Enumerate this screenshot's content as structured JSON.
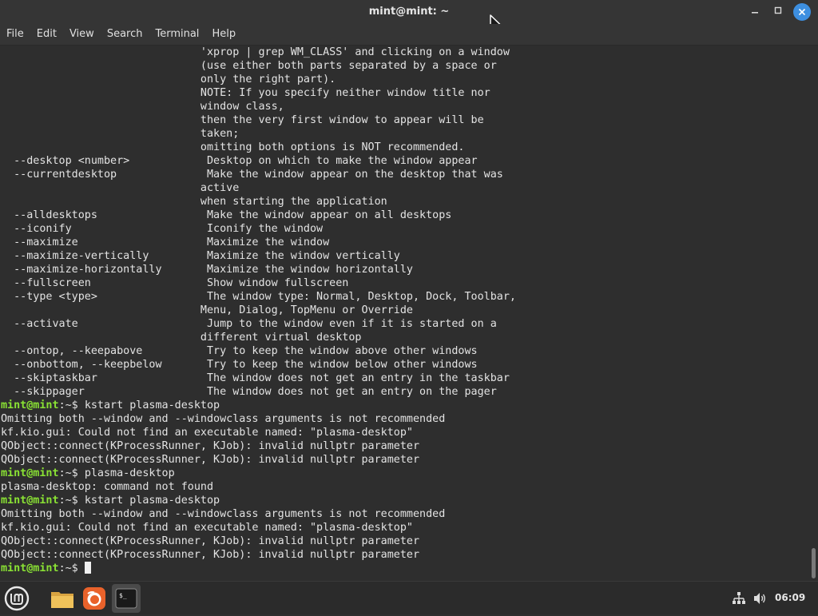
{
  "window": {
    "title": "mint@mint: ~"
  },
  "menu": [
    "File",
    "Edit",
    "View",
    "Search",
    "Terminal",
    "Help"
  ],
  "terminal_lines": [
    {
      "type": "out",
      "text": "                               'xprop | grep WM_CLASS' and clicking on a window"
    },
    {
      "type": "out",
      "text": "                               (use either both parts separated by a space or"
    },
    {
      "type": "out",
      "text": "                               only the right part)."
    },
    {
      "type": "out",
      "text": "                               NOTE: If you specify neither window title nor"
    },
    {
      "type": "out",
      "text": "                               window class,"
    },
    {
      "type": "out",
      "text": "                               then the very first window to appear will be"
    },
    {
      "type": "out",
      "text": "                               taken;"
    },
    {
      "type": "out",
      "text": "                               omitting both options is NOT recommended."
    },
    {
      "type": "out",
      "text": "  --desktop <number>            Desktop on which to make the window appear"
    },
    {
      "type": "out",
      "text": "  --currentdesktop              Make the window appear on the desktop that was"
    },
    {
      "type": "out",
      "text": "                               active"
    },
    {
      "type": "out",
      "text": "                               when starting the application"
    },
    {
      "type": "out",
      "text": "  --alldesktops                 Make the window appear on all desktops"
    },
    {
      "type": "out",
      "text": "  --iconify                     Iconify the window"
    },
    {
      "type": "out",
      "text": "  --maximize                    Maximize the window"
    },
    {
      "type": "out",
      "text": "  --maximize-vertically         Maximize the window vertically"
    },
    {
      "type": "out",
      "text": "  --maximize-horizontally       Maximize the window horizontally"
    },
    {
      "type": "out",
      "text": "  --fullscreen                  Show window fullscreen"
    },
    {
      "type": "out",
      "text": "  --type <type>                 The window type: Normal, Desktop, Dock, Toolbar,"
    },
    {
      "type": "out",
      "text": "                               Menu, Dialog, TopMenu or Override"
    },
    {
      "type": "out",
      "text": "  --activate                    Jump to the window even if it is started on a"
    },
    {
      "type": "out",
      "text": "                               different virtual desktop"
    },
    {
      "type": "out",
      "text": "  --ontop, --keepabove          Try to keep the window above other windows"
    },
    {
      "type": "out",
      "text": "  --onbottom, --keepbelow       Try to keep the window below other windows"
    },
    {
      "type": "out",
      "text": "  --skiptaskbar                 The window does not get an entry in the taskbar"
    },
    {
      "type": "out",
      "text": "  --skippager                   The window does not get an entry on the pager"
    },
    {
      "type": "prompt",
      "prompt": "mint@mint",
      "sym": ":~$ ",
      "text": "kstart plasma-desktop"
    },
    {
      "type": "out",
      "text": "Omitting both --window and --windowclass arguments is not recommended"
    },
    {
      "type": "out",
      "text": "kf.kio.gui: Could not find an executable named: \"plasma-desktop\""
    },
    {
      "type": "out",
      "text": "QObject::connect(KProcessRunner, KJob): invalid nullptr parameter"
    },
    {
      "type": "out",
      "text": "QObject::connect(KProcessRunner, KJob): invalid nullptr parameter"
    },
    {
      "type": "prompt",
      "prompt": "mint@mint",
      "sym": ":~$ ",
      "text": "plasma-desktop"
    },
    {
      "type": "out",
      "text": "plasma-desktop: command not found"
    },
    {
      "type": "prompt",
      "prompt": "mint@mint",
      "sym": ":~$ ",
      "text": "kstart plasma-desktop"
    },
    {
      "type": "out",
      "text": "Omitting both --window and --windowclass arguments is not recommended"
    },
    {
      "type": "out",
      "text": "kf.kio.gui: Could not find an executable named: \"plasma-desktop\""
    },
    {
      "type": "out",
      "text": "QObject::connect(KProcessRunner, KJob): invalid nullptr parameter"
    },
    {
      "type": "out",
      "text": "QObject::connect(KProcessRunner, KJob): invalid nullptr parameter"
    },
    {
      "type": "prompt",
      "prompt": "mint@mint",
      "sym": ":~$ ",
      "text": "",
      "cursor": true
    }
  ],
  "taskbar": {
    "clock": "06:09",
    "apps": [
      "menu-icon",
      "files-icon",
      "firefox-icon",
      "terminal-icon"
    ]
  }
}
